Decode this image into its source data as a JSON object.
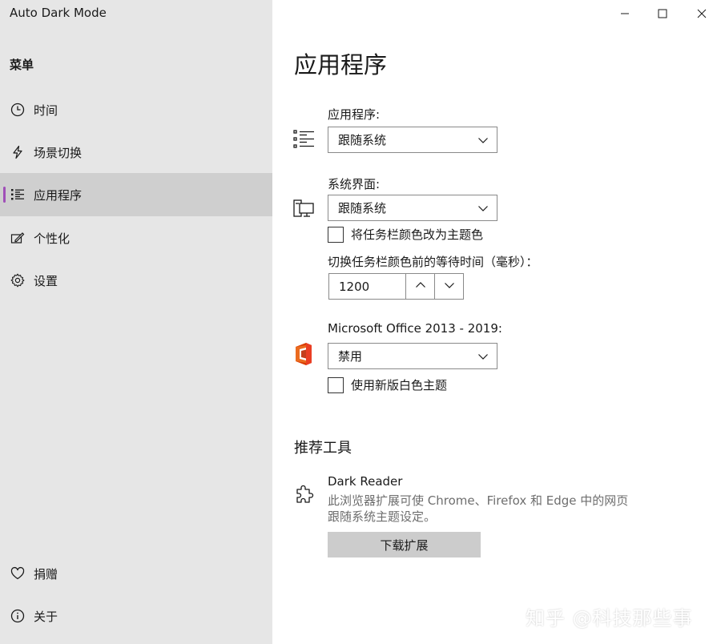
{
  "window": {
    "title": "Auto Dark Mode",
    "controls": {
      "minimize": "minimize-icon",
      "maximize": "maximize-icon",
      "close": "close-icon"
    }
  },
  "sidebar": {
    "heading": "菜单",
    "items": [
      {
        "label": "时间",
        "icon": "clock-icon"
      },
      {
        "label": "场景切换",
        "icon": "lightning-icon"
      },
      {
        "label": "应用程序",
        "icon": "list-icon",
        "selected": true
      },
      {
        "label": "个性化",
        "icon": "paint-icon"
      },
      {
        "label": "设置",
        "icon": "gear-icon"
      }
    ],
    "bottom_items": [
      {
        "label": "捐赠",
        "icon": "heart-icon"
      },
      {
        "label": "关于",
        "icon": "info-icon"
      }
    ],
    "accent_color": "#a04fb8"
  },
  "main": {
    "title": "应用程序",
    "apps": {
      "label": "应用程序:",
      "value": "跟随系统"
    },
    "system": {
      "label": "系统界面:",
      "value": "跟随系统",
      "taskbar_checkbox": "将任务栏颜色改为主题色",
      "wait_label": "切换任务栏颜色前的等待时间（毫秒）：",
      "wait_value": "1200"
    },
    "office": {
      "label": "Microsoft Office 2013 - 2019:",
      "value": "禁用",
      "white_theme_checkbox": "使用新版白色主题"
    },
    "recommended": {
      "title": "推荐工具",
      "tool_name": "Dark Reader",
      "tool_desc_line1": "此浏览器扩展可使 Chrome、Firefox 和 Edge 中的网页",
      "tool_desc_line2": "跟随系统主题设定。",
      "button": "下载扩展"
    }
  },
  "watermark": "知乎 @科技那些事"
}
